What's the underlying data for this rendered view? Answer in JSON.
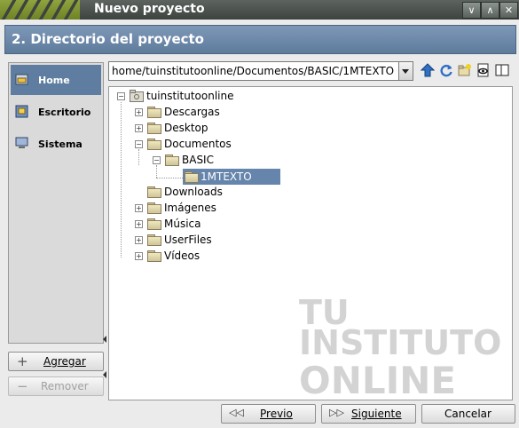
{
  "window": {
    "title": "Nuevo proyecto",
    "controls": [
      "minimize-icon",
      "maximize-icon",
      "close-icon"
    ]
  },
  "header": {
    "title": "2. Directorio del proyecto"
  },
  "sidebar": {
    "items": [
      {
        "label": "Home",
        "icon": "home-icon",
        "selected": true
      },
      {
        "label": "Escritorio",
        "icon": "desktop-icon",
        "selected": false
      },
      {
        "label": "Sistema",
        "icon": "computer-icon",
        "selected": false
      }
    ],
    "add_label": "Agregar",
    "remove_label": "Remover"
  },
  "path": {
    "value": "home/tuinstitutoonline/Documentos/BASIC/1MTEXTO"
  },
  "toolbar": {
    "icons": [
      "go-up-icon",
      "refresh-icon",
      "new-folder-icon",
      "show-hidden-icon",
      "view-toggle-icon"
    ]
  },
  "tree": {
    "root": "tuinstitutoonline",
    "children": [
      {
        "label": "Descargas",
        "expander": "+"
      },
      {
        "label": "Desktop",
        "expander": "+"
      },
      {
        "label": "Documentos",
        "expander": "-"
      },
      {
        "label": "BASIC",
        "expander": "-"
      },
      {
        "label": "1MTEXTO",
        "expander": "",
        "selected": true
      },
      {
        "label": "Downloads",
        "expander": ""
      },
      {
        "label": "Imágenes",
        "expander": "+"
      },
      {
        "label": "Música",
        "expander": "+"
      },
      {
        "label": "UserFiles",
        "expander": "+"
      },
      {
        "label": "Vídeos",
        "expander": "+"
      }
    ]
  },
  "watermark": {
    "line1": "TU",
    "line2": "INSTITUTO",
    "line3": "ONLINE"
  },
  "footer": {
    "prev_label": "Previo",
    "next_label": "Siguiente",
    "cancel_label": "Cancelar"
  },
  "colors": {
    "accent": "#5e7da0",
    "header": "#6c88aa",
    "titlebar": "#4a504c"
  }
}
